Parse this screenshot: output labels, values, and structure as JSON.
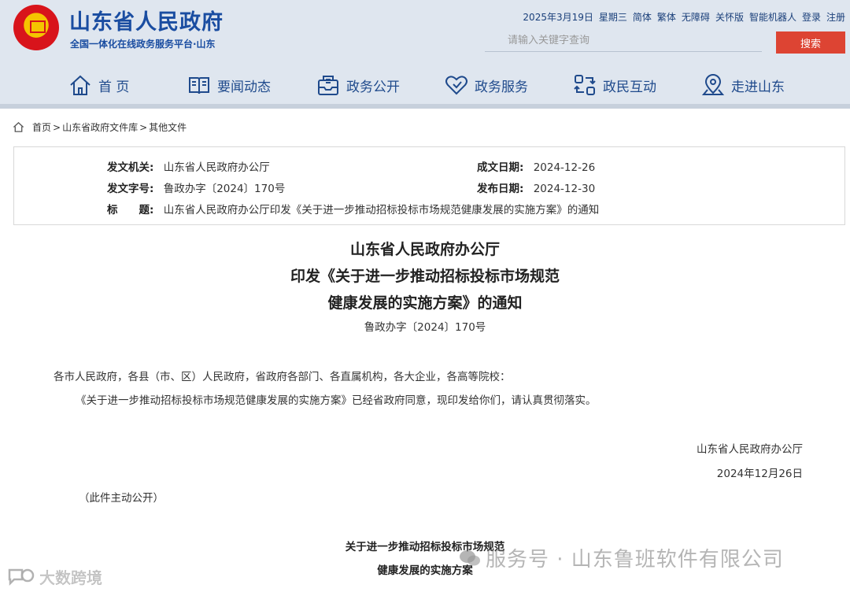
{
  "header": {
    "site_title": "山东省人民政府",
    "site_subtitle": "全国一体化在线政务服务平台·山东",
    "top_links": [
      "2025年3月19日",
      "星期三",
      "简体",
      "繁体",
      "无障碍",
      "关怀版",
      "智能机器人",
      "登录",
      "注册"
    ],
    "search_placeholder": "请输入关键字查询",
    "search_button": "搜索",
    "brand_color": "#1a4da1",
    "search_button_color": "#dd4433"
  },
  "nav": {
    "items": [
      {
        "label": "首 页",
        "icon": "home-icon"
      },
      {
        "label": "要闻动态",
        "icon": "book-icon"
      },
      {
        "label": "政务公开",
        "icon": "inbox-icon"
      },
      {
        "label": "政务服务",
        "icon": "heart-icon"
      },
      {
        "label": "政民互动",
        "icon": "exchange-icon"
      },
      {
        "label": "走进山东",
        "icon": "location-icon"
      }
    ]
  },
  "breadcrumb": {
    "items": [
      "首页",
      ">",
      "山东省政府文件库",
      ">",
      "其他文件"
    ]
  },
  "info": {
    "issuer_label": "发文机关:",
    "issuer": "山东省人民政府办公厅",
    "created_label": "成文日期:",
    "created": "2024-12-26",
    "docno_label": "发文字号:",
    "docno": "鲁政办字〔2024〕170号",
    "published_label": "发布日期:",
    "published": "2024-12-30",
    "title_label": "标　　题:",
    "title": "山东省人民政府办公厅印发《关于进一步推动招标投标市场规范健康发展的实施方案》的通知"
  },
  "document": {
    "title_lines": [
      "山东省人民政府办公厅",
      "印发《关于进一步推动招标投标市场规范",
      "健康发展的实施方案》的通知"
    ],
    "doc_no": "鲁政办字〔2024〕170号",
    "salutation": "各市人民政府，各县（市、区）人民政府，省政府各部门、各直属机构，各大企业，各高等院校：",
    "body": "《关于进一步推动招标投标市场规范健康发展的实施方案》已经省政府同意，现印发给你们，请认真贯彻落实。",
    "signature": "山东省人民政府办公厅",
    "date": "2024年12月26日",
    "note": "（此件主动公开）",
    "attachment_title_lines": [
      "关于进一步推动招标投标市场规范",
      "健康发展的实施方案"
    ]
  },
  "watermarks": {
    "right": "服务号 · 山东鲁班软件有限公司",
    "left": "大数跨境"
  }
}
